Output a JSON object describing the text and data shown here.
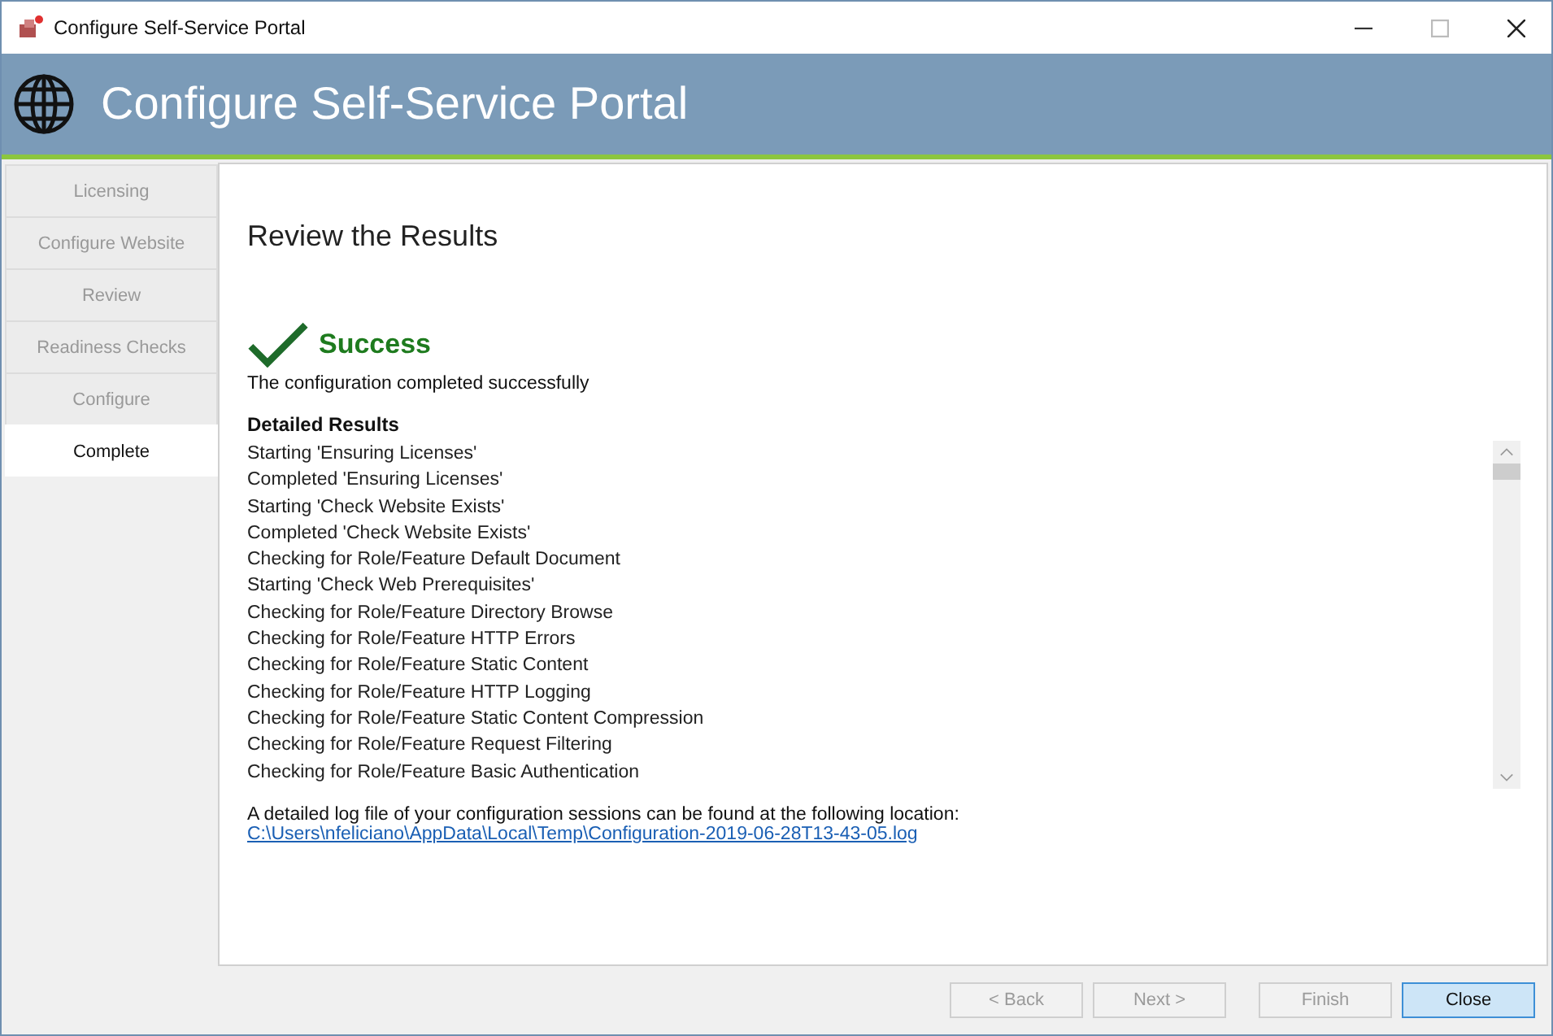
{
  "window": {
    "title": "Configure Self-Service Portal"
  },
  "header": {
    "title": "Configure Self-Service Portal"
  },
  "steps": [
    {
      "label": "Licensing",
      "selected": false
    },
    {
      "label": "Configure Website",
      "selected": false
    },
    {
      "label": "Review",
      "selected": false
    },
    {
      "label": "Readiness Checks",
      "selected": false
    },
    {
      "label": "Configure",
      "selected": false
    },
    {
      "label": "Complete",
      "selected": true
    }
  ],
  "page_title": "Review the Results",
  "status": {
    "kind": "success",
    "title": "Success",
    "message": "The configuration completed successfully"
  },
  "results": {
    "heading": "Detailed Results",
    "lines": [
      "Starting 'Ensuring Licenses'",
      "Completed 'Ensuring Licenses'",
      "Starting 'Check Website Exists'",
      "Completed 'Check Website Exists'",
      "Checking for Role/Feature Default Document",
      "Starting 'Check Web Prerequisites'",
      "Checking for Role/Feature Directory Browse",
      "Checking for Role/Feature HTTP Errors",
      "Checking for Role/Feature Static Content",
      "Checking for Role/Feature HTTP Logging",
      "Checking for Role/Feature Static Content Compression",
      "Checking for Role/Feature Request Filtering",
      "Checking for Role/Feature Basic Authentication"
    ]
  },
  "log": {
    "text": "A detailed log file of your configuration sessions can be found at the following location:",
    "path": "C:\\Users\\nfeliciano\\AppData\\Local\\Temp\\Configuration-2019-06-28T13-43-05.log"
  },
  "buttons": [
    {
      "label": "< Back",
      "disabled": true,
      "default": false
    },
    {
      "label": "Next >",
      "disabled": true,
      "default": false
    },
    {
      "label": "Finish",
      "disabled": true,
      "default": false
    },
    {
      "label": "Close",
      "disabled": false,
      "default": true
    }
  ]
}
